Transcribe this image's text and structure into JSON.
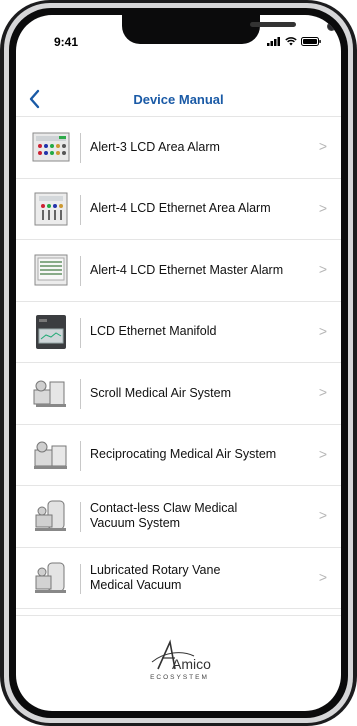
{
  "status_bar": {
    "time": "9:41"
  },
  "nav": {
    "title": "Device Manual"
  },
  "items": [
    {
      "label": "Alert-3 LCD Area Alarm",
      "thumb": "alert3-panel-thumbnail"
    },
    {
      "label": "Alert-4 LCD Ethernet Area Alarm",
      "thumb": "alert4-panel-thumbnail"
    },
    {
      "label": "Alert-4 LCD Ethernet Master Alarm",
      "thumb": "alert4-master-thumbnail"
    },
    {
      "label": "LCD Ethernet Manifold",
      "thumb": "manifold-thumbnail"
    },
    {
      "label": "Scroll Medical Air System",
      "thumb": "scroll-air-thumbnail"
    },
    {
      "label": "Reciprocating Medical Air System",
      "thumb": "reciprocating-air-thumbnail"
    },
    {
      "label": "Contact-less Claw Medical\nVacuum System",
      "thumb": "claw-vacuum-thumbnail"
    },
    {
      "label": "Lubricated Rotary Vane\nMedical Vacuum",
      "thumb": "rotary-vane-thumbnail"
    }
  ],
  "footer": {
    "logo_main": "Amico",
    "logo_sub": "ECOSYSTEM"
  },
  "colors": {
    "accent": "#1a5aa6",
    "separator": "#e5e5e5",
    "chevron": "#b5b5b5"
  },
  "icons": {
    "back": "chevron-left-icon",
    "row": "chevron-right-icon"
  },
  "chevron_glyph": ">"
}
